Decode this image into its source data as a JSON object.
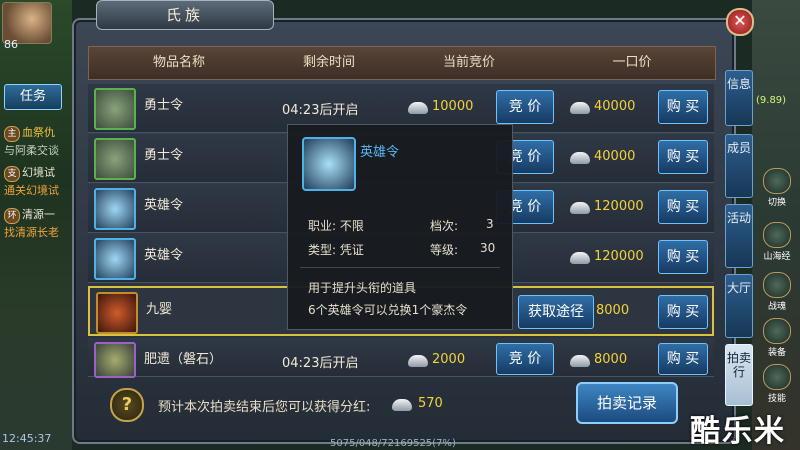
{
  "window": {
    "title": "氏族",
    "close_label": "✕"
  },
  "player": {
    "level": "86",
    "time": "12:45:37"
  },
  "left_hud": {
    "task_button": "任务",
    "quests": [
      {
        "tag": "主",
        "title": "血祭仇",
        "sub": "与阿柔交谈"
      },
      {
        "tag": "支",
        "title": "幻境试",
        "sub": "通关幻境试"
      },
      {
        "tag": "环",
        "title": "清源一",
        "sub": "找清源长老"
      }
    ]
  },
  "right_hud": {
    "coord_text": "(9.89)",
    "buttons": [
      "切换",
      "山海经",
      "战魂",
      "装备",
      "技能"
    ]
  },
  "table": {
    "headers": [
      "物品名称",
      "剩余时间",
      "当前竞价",
      "一口价"
    ],
    "rows": [
      {
        "name": "勇士令",
        "remain": "04:23后开启",
        "bid": "10000",
        "bid_button": "竞 价",
        "buyout": "40000",
        "buy_button": "购 买"
      },
      {
        "name": "勇士令",
        "remain": "",
        "bid": "",
        "bid_button": "竞 价",
        "buyout": "40000",
        "buy_button": "购 买"
      },
      {
        "name": "英雄令",
        "remain": "",
        "bid": "",
        "bid_button": "竞 价",
        "buyout": "120000",
        "buy_button": "购 买"
      },
      {
        "name": "英雄令",
        "remain": "",
        "bid": "",
        "bid_button": "",
        "buyout": "120000",
        "buy_button": "购 买"
      },
      {
        "name": "九婴",
        "remain": "",
        "bid": "",
        "bid_button": "获取途径",
        "buyout": "8000",
        "buy_button": "购 买"
      },
      {
        "name": "肥遗（磐石）",
        "remain": "04:23后开启",
        "bid": "2000",
        "bid_button": "竞 价",
        "buyout": "8000",
        "buy_button": "购 买"
      }
    ]
  },
  "side_tabs": [
    "信息",
    "成员",
    "活动",
    "大厅",
    "拍卖行"
  ],
  "bottom": {
    "help_label": "?",
    "dividend_text": "预计本次拍卖结束后您可以获得分红:",
    "dividend_value": "570",
    "record_button": "拍卖记录"
  },
  "tooltip": {
    "title": "英雄令",
    "job_label": "职业: 不限",
    "grade_label": "档次:",
    "grade_value": "3",
    "type_label": "类型: 凭证",
    "level_label": "等级:",
    "level_value": "30",
    "desc1": "用于提升头衔的道具",
    "desc2": "6个英雄令可以兑换1个豪杰令"
  },
  "watermark": "酷乐米",
  "bottom_coord": "5075/048/72169525(7%)"
}
